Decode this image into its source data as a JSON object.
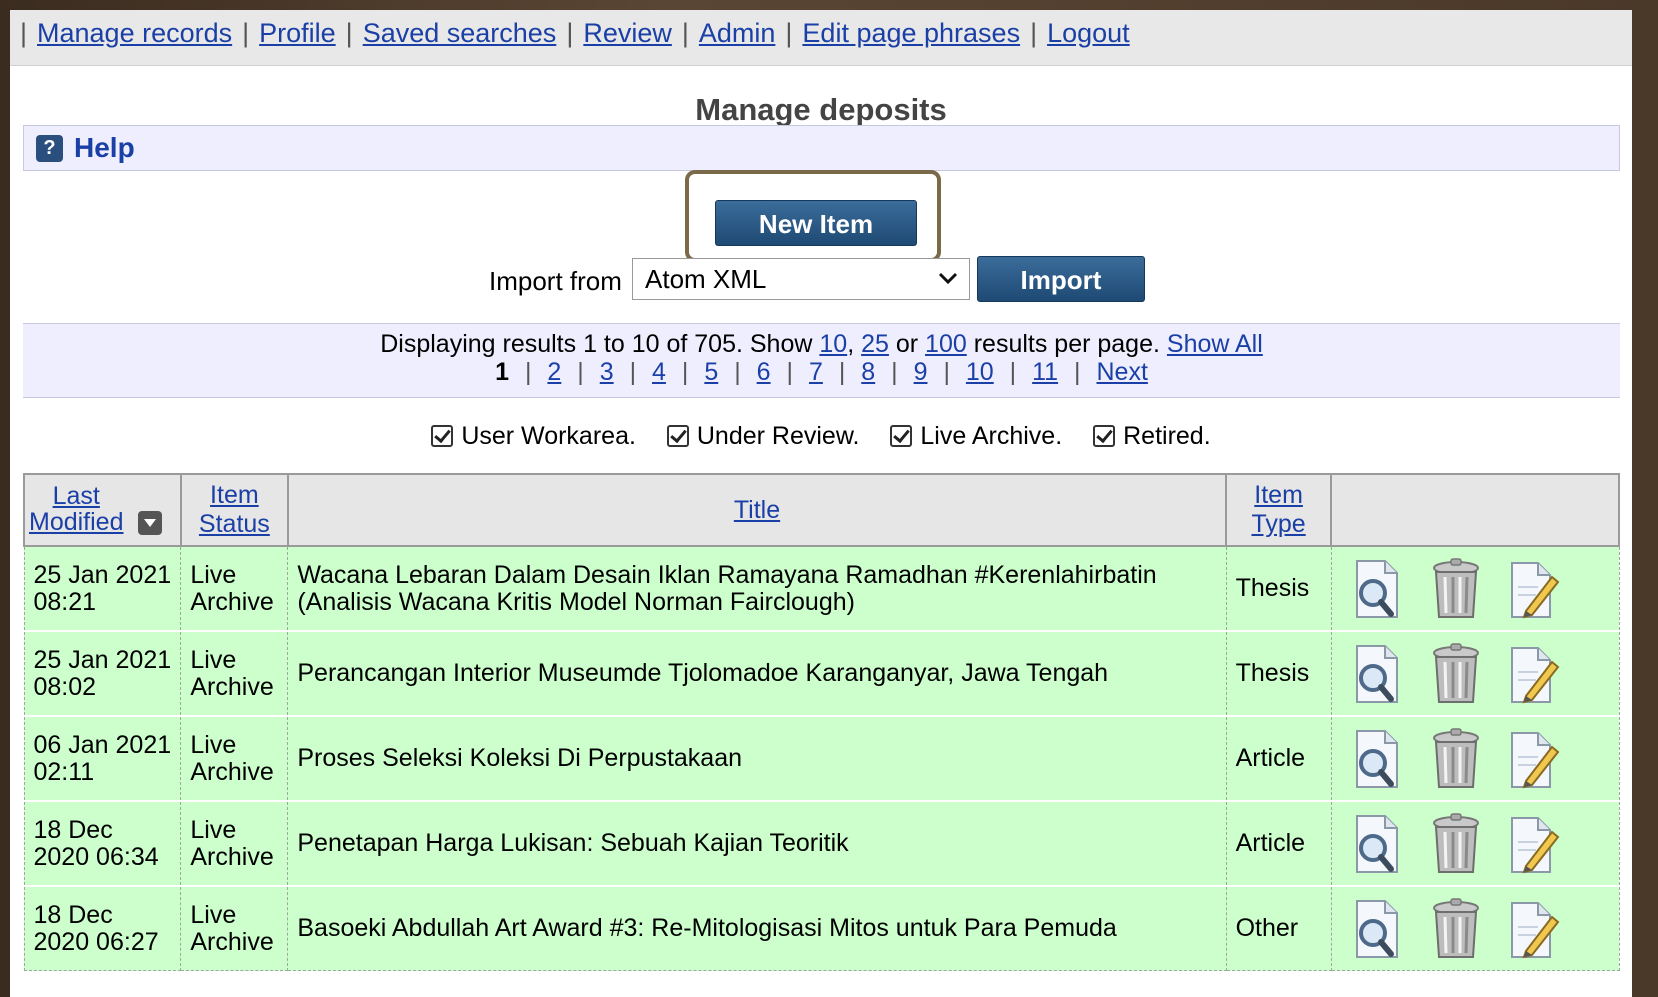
{
  "nav": {
    "items": [
      "Manage records",
      "Profile",
      "Saved searches",
      "Review",
      "Admin",
      "Edit page phrases",
      "Logout"
    ]
  },
  "page": {
    "title": "Manage deposits",
    "help": "Help",
    "new_item": "New Item",
    "import_label": "Import from",
    "import_selected": "Atom XML",
    "import_button": "Import"
  },
  "paging": {
    "text_a": "Displaying results 1 to 10 of 705. Show",
    "opt10": "10",
    "opt25": "25",
    "or": "or",
    "opt100": "100",
    "text_b": "results per page.",
    "show_all": "Show All",
    "current": "1",
    "pages": [
      "2",
      "3",
      "4",
      "5",
      "6",
      "7",
      "8",
      "9",
      "10",
      "11"
    ],
    "next": "Next"
  },
  "filters": [
    "User Workarea.",
    "Under Review.",
    "Live Archive.",
    "Retired."
  ],
  "table": {
    "headers": {
      "last_modified_1": "Last",
      "last_modified_2": "Modified",
      "status_1": "Item",
      "status_2": "Status",
      "title": "Title",
      "type_1": "Item",
      "type_2": "Type"
    },
    "rows": [
      {
        "date1": "25 Jan 2021",
        "date2": "08:21",
        "status1": "Live",
        "status2": "Archive",
        "title1": "Wacana Lebaran Dalam Desain Iklan Ramayana Ramadhan #Kerenlahirbatin",
        "title2": "(Analisis Wacana Kritis Model Norman Fairclough)",
        "type": "Thesis"
      },
      {
        "date1": "25 Jan 2021",
        "date2": "08:02",
        "status1": "Live",
        "status2": "Archive",
        "title1": "Perancangan Interior Museumde Tjolomadoe Karanganyar, Jawa Tengah",
        "title2": "",
        "type": "Thesis"
      },
      {
        "date1": "06 Jan 2021",
        "date2": "02:11",
        "status1": "Live",
        "status2": "Archive",
        "title1": "Proses Seleksi Koleksi Di Perpustakaan",
        "title2": "",
        "type": "Article"
      },
      {
        "date1": "18 Dec",
        "date2": "2020 06:34",
        "status1": "Live",
        "status2": "Archive",
        "title1": "Penetapan Harga Lukisan: Sebuah Kajian Teoritik",
        "title2": "",
        "type": "Article"
      },
      {
        "date1": "18 Dec",
        "date2": "2020 06:27",
        "status1": "Live",
        "status2": "Archive",
        "title1": "Basoeki Abdullah Art Award #3: Re-Mitologisasi Mitos untuk Para Pemuda",
        "title2": "",
        "type": "Other"
      }
    ]
  }
}
